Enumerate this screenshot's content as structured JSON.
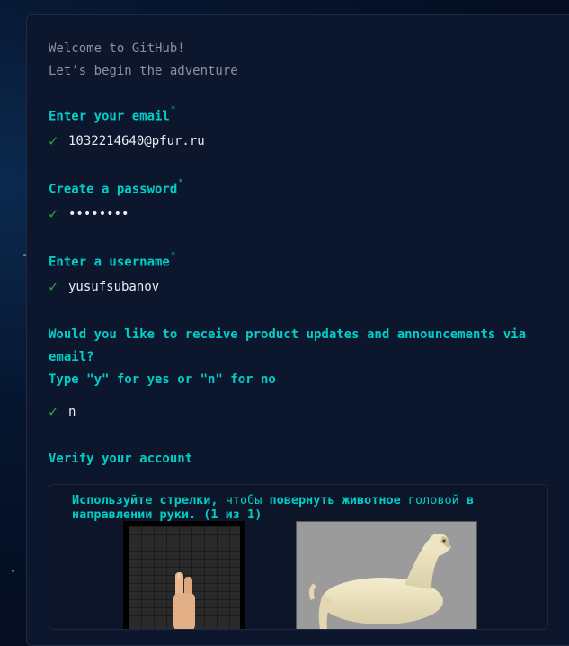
{
  "intro": {
    "welcome": "Welcome to GitHub!",
    "subtitle": "Let’s begin the adventure"
  },
  "fields": {
    "email": {
      "label": "Enter your email",
      "required_mark": "*",
      "value": "1032214640@pfur.ru"
    },
    "password": {
      "label": "Create a password",
      "required_mark": "*",
      "value": "••••••••"
    },
    "username": {
      "label": "Enter a username",
      "required_mark": "*",
      "value": "yusufsubanov"
    }
  },
  "updates": {
    "question": "Would you like to receive product updates and announcements via email?",
    "hint": "Type \"y\" for yes or \"n\" for no",
    "value": "n"
  },
  "verify": {
    "label": "Verify your account",
    "captcha_title_1": "Используйте стрелки,",
    "captcha_title_2": " чтобы ",
    "captcha_title_3": "повернуть животное",
    "captcha_title_4": " головой ",
    "captcha_title_5": "в направлении руки. (1 из 1)"
  },
  "check_glyph": "✓",
  "colors": {
    "accent": "#00cfc8",
    "check": "#2ea043",
    "panel": "#0c162d",
    "background": "#040d21"
  }
}
